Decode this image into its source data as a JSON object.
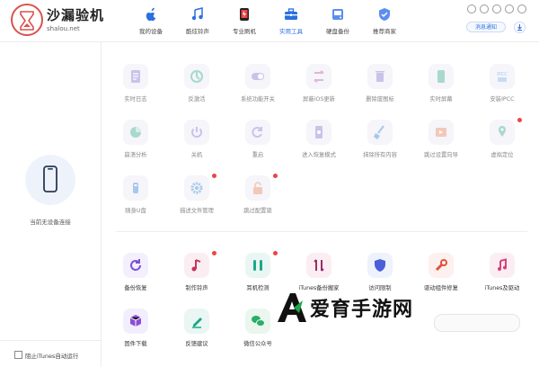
{
  "app": {
    "brand": "沙漏验机",
    "brand_url": "shalou.net",
    "colors": {
      "accent": "#2b6fe0",
      "brand_red": "#d9534f",
      "badge": "#e44"
    }
  },
  "nav": [
    {
      "label": "我的设备",
      "icon": "apple-icon",
      "active": false
    },
    {
      "label": "酷炫铃声",
      "icon": "music-note-icon",
      "active": false
    },
    {
      "label": "专业刷机",
      "icon": "phone-flash-icon",
      "active": false
    },
    {
      "label": "实用工具",
      "icon": "toolbox-icon",
      "active": true
    },
    {
      "label": "硬盘备份",
      "icon": "disk-backup-icon",
      "active": false
    },
    {
      "label": "推荐商家",
      "icon": "shield-check-icon",
      "active": false
    }
  ],
  "header": {
    "messages_label": "消息通知"
  },
  "sidebar": {
    "no_device": "当前无设备连接",
    "itunes_option": "阻止iTunes自动运行"
  },
  "tools_disabled": [
    {
      "label": "实时日志",
      "icon": "log-icon",
      "badge": false
    },
    {
      "label": "反激活",
      "icon": "deactivate-icon",
      "badge": false
    },
    {
      "label": "系统功能开关",
      "icon": "toggle-icon",
      "badge": false
    },
    {
      "label": "屏蔽iOS更新",
      "icon": "block-update-icon",
      "badge": false
    },
    {
      "label": "删除废图标",
      "icon": "trash-icon",
      "badge": false
    },
    {
      "label": "实时屏幕",
      "icon": "screen-icon",
      "badge": false
    },
    {
      "label": "安装IPCC",
      "icon": "ipcc-icon",
      "badge": false
    },
    {
      "label": "崩溃分析",
      "icon": "pie-icon",
      "badge": false
    },
    {
      "label": "关机",
      "icon": "power-icon",
      "badge": false
    },
    {
      "label": "重启",
      "icon": "restart-icon",
      "badge": false
    },
    {
      "label": "进入恢复模式",
      "icon": "recovery-icon",
      "badge": false
    },
    {
      "label": "抹除所有内容",
      "icon": "broom-icon",
      "badge": false
    },
    {
      "label": "跳过设置向导",
      "icon": "skip-icon",
      "badge": false
    },
    {
      "label": "虚拟定位",
      "icon": "location-icon",
      "badge": true
    },
    {
      "label": "随身U盘",
      "icon": "usb-icon",
      "badge": false
    },
    {
      "label": "描述文件管理",
      "icon": "gear-icon",
      "badge": true
    },
    {
      "label": "跳过配置锁",
      "icon": "unlock-icon",
      "badge": true
    }
  ],
  "tools_enabled": [
    {
      "label": "备份恢复",
      "icon": "backup-restore-icon",
      "badge": false
    },
    {
      "label": "制作铃声",
      "icon": "ringtone-icon",
      "badge": true
    },
    {
      "label": "耳机检测",
      "icon": "earphones-icon",
      "badge": true
    },
    {
      "label": "iTunes备份搬家",
      "icon": "transfer-icon",
      "badge": false
    },
    {
      "label": "访问限制",
      "icon": "shield-icon",
      "badge": false
    },
    {
      "label": "驱动组件修复",
      "icon": "wrench-icon",
      "badge": false
    },
    {
      "label": "iTunes及驱动",
      "icon": "itunes-icon",
      "badge": false
    },
    {
      "label": "固件下载",
      "icon": "cube-icon",
      "badge": false
    },
    {
      "label": "反馈建议",
      "icon": "pen-icon",
      "badge": false
    },
    {
      "label": "微信公众号",
      "icon": "wechat-icon",
      "badge": false
    }
  ],
  "watermark": {
    "text": "爱育手游网"
  }
}
